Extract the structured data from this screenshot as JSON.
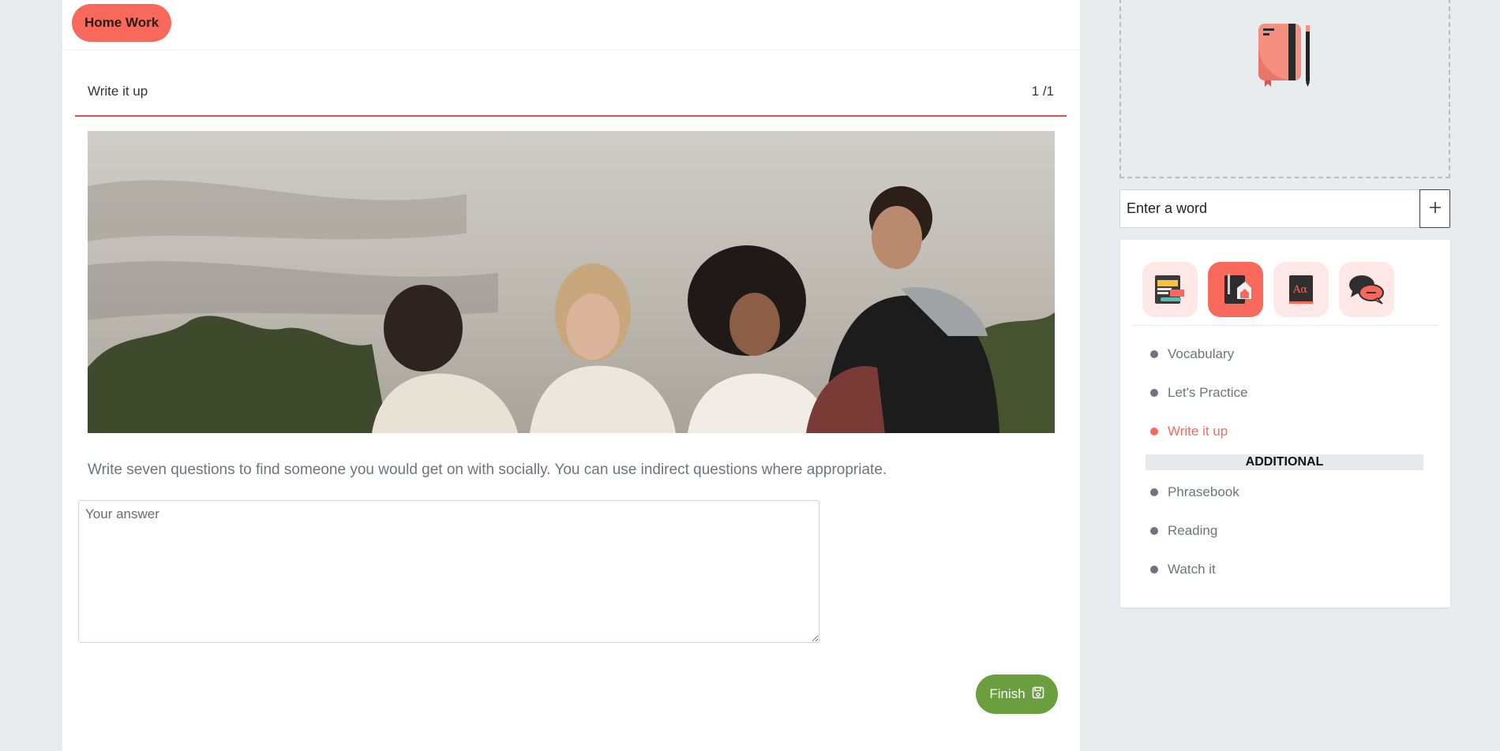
{
  "header": {
    "badge_label": "Home Work"
  },
  "section": {
    "title": "Write it up",
    "counter": "1 /1"
  },
  "task": {
    "instruction": "Write seven questions to find someone you would get on with socially. You can use indirect questions where appropriate.",
    "answer_placeholder": "Your answer",
    "answer_value": ""
  },
  "finish_button": {
    "label": "Finish",
    "icon": "save-icon"
  },
  "word_input": {
    "placeholder": "Enter a word",
    "add_icon": "plus-icon"
  },
  "sidebar": {
    "icons": [
      {
        "name": "vocabulary-icon",
        "active": false
      },
      {
        "name": "homework-icon",
        "active": true
      },
      {
        "name": "dictionary-icon",
        "active": false
      },
      {
        "name": "speech-bubble-icon",
        "active": false
      }
    ],
    "items": [
      {
        "label": "Vocabulary",
        "active": false
      },
      {
        "label": "Let's Practice",
        "active": false
      },
      {
        "label": "Write it up",
        "active": true
      }
    ],
    "additional_heading": "ADDITIONAL",
    "additional_items": [
      {
        "label": "Phrasebook"
      },
      {
        "label": "Reading"
      },
      {
        "label": "Watch it"
      }
    ]
  },
  "colors": {
    "accent": "#f9695b",
    "finish_green": "#6a9e3f",
    "divider_red": "#d9534f",
    "background": "#e9ecef"
  }
}
